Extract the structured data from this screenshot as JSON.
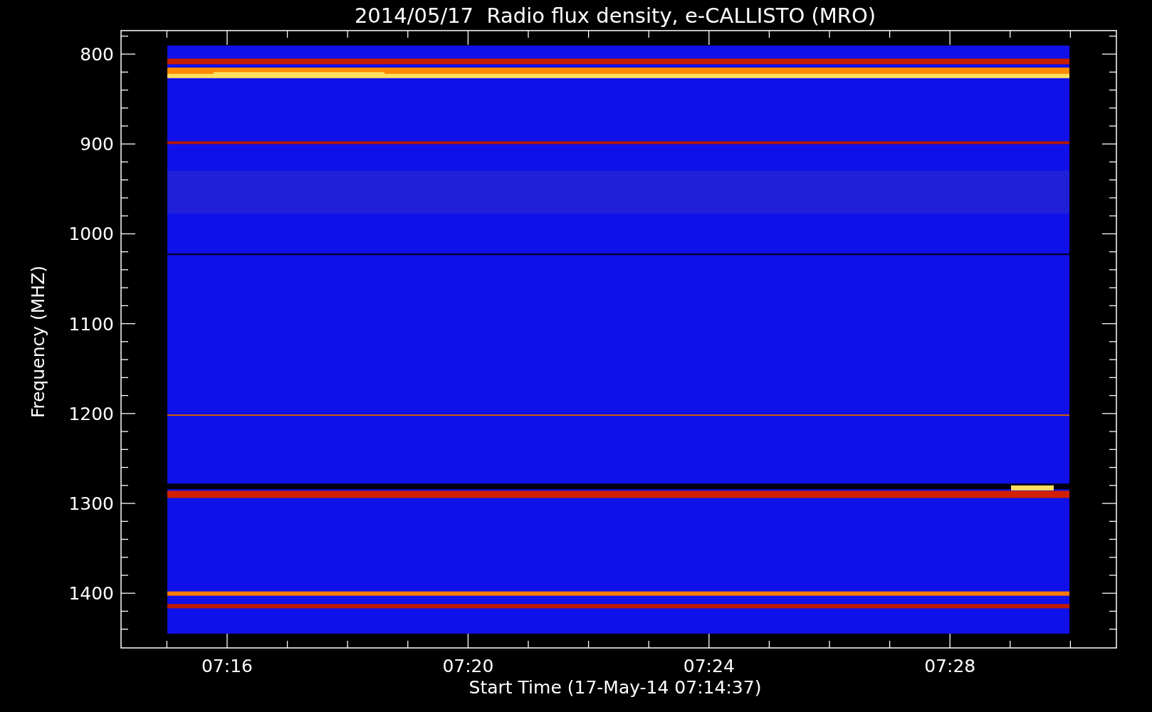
{
  "title": "2014/05/17  Radio flux density, e-CALLISTO (MRO)",
  "y_axis": {
    "label": "Frequency (MHZ)",
    "ticks": [
      "800",
      "900",
      "1000",
      "1100",
      "1200",
      "1300",
      "1400"
    ]
  },
  "x_axis": {
    "label": "Start Time (17-May-14 07:14:37)",
    "ticks": [
      "07:16",
      "07:20",
      "07:24",
      "07:28"
    ]
  }
}
